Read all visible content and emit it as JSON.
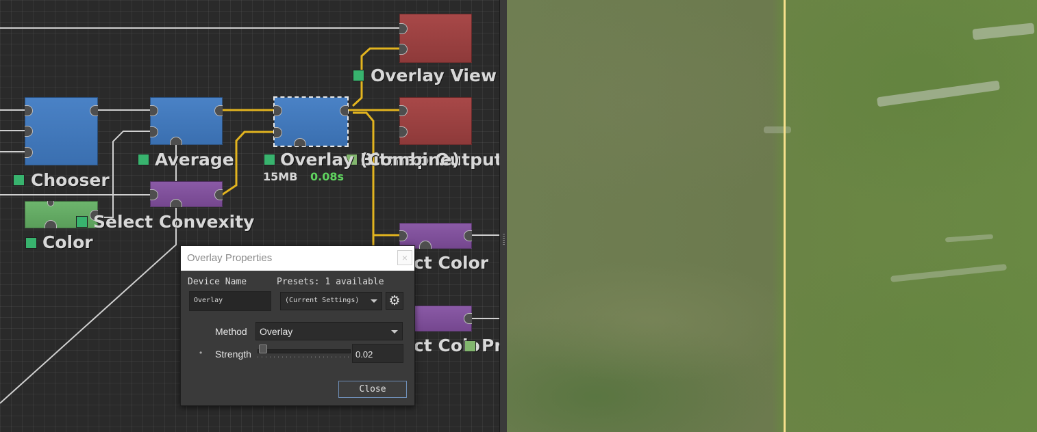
{
  "nodes": {
    "chooser": {
      "label": "Chooser"
    },
    "average": {
      "label": "Average"
    },
    "overlay": {
      "label": "Overlay (Combine)",
      "memory": "15MB",
      "time": "0.08s"
    },
    "overlay_view": {
      "label": "Overlay View"
    },
    "output": {
      "label": "Bitmap Output"
    },
    "select_convexity": {
      "label": "Select Convexity"
    },
    "color": {
      "label": "Color"
    },
    "select_color_1": {
      "label": "ct Color"
    },
    "select_color_2": {
      "label": "ct Colo"
    },
    "partial_label": {
      "label": "Pr"
    }
  },
  "colors": {
    "node_blue": "#3a6fb0",
    "node_red": "#8e3a3a",
    "node_purple": "#75478f",
    "node_green": "#5a9e5a",
    "wire_active": "#e2b41f",
    "wire_default": "#d0d0d0",
    "enabled_check": "#38b36e",
    "time_text": "#5fd35f",
    "viewer_divider": "#f6e08c"
  },
  "dialog": {
    "title": "Overlay Properties",
    "close_glyph": "×",
    "device_name_label": "Device Name",
    "device_name_value": "Overlay",
    "presets_label": "Presets: 1 available",
    "presets_value": "(Current Settings)",
    "settings_icon": "gear-icon",
    "settings_glyph": "⚙",
    "method_label": "Method",
    "method_value": "Overlay",
    "strength_bullet": "•",
    "strength_label": "Strength",
    "strength_value": "0.02",
    "strength_fraction": 0.02,
    "close_button": "Close"
  }
}
